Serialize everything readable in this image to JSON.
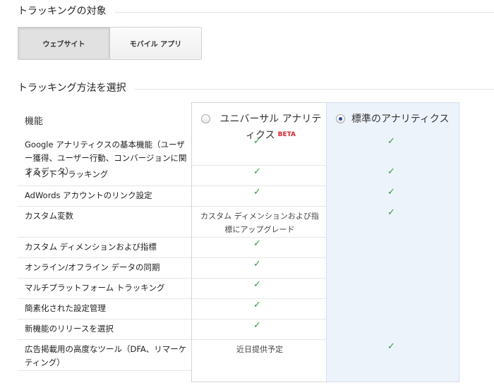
{
  "tracking_target": {
    "title": "トラッキングの対象",
    "tabs": [
      {
        "label": "ウェブサイト",
        "active": true
      },
      {
        "label": "モバイル アプリ",
        "active": false
      }
    ]
  },
  "tracking_method": {
    "title": "トラッキング方法を選択",
    "feature_header": "機能",
    "options": [
      {
        "label": "ユニバーサル アナリティクス",
        "badge": "BETA",
        "selected": false
      },
      {
        "label": "標準のアナリティクス",
        "selected": true
      }
    ],
    "rows": [
      {
        "feature": "Google アナリティクスの基本機能（ユーザー獲得、ユーザー行動、コンバージョンに関するデータ）",
        "universal": "check",
        "standard": "check"
      },
      {
        "feature": "イベント トラッキング",
        "universal": "check",
        "standard": "check"
      },
      {
        "feature": "AdWords アカウントのリンク設定",
        "universal": "check",
        "standard": "check"
      },
      {
        "feature": "カスタム変数",
        "universal": "カスタム ディメンションおよび指標にアップグレード",
        "standard": "check"
      },
      {
        "feature": "カスタム ディメンションおよび指標",
        "universal": "check",
        "standard": ""
      },
      {
        "feature": "オンライン/オフライン データの同期",
        "universal": "check",
        "standard": ""
      },
      {
        "feature": "マルチプラットフォーム トラッキング",
        "universal": "check",
        "standard": ""
      },
      {
        "feature": "簡素化された設定管理",
        "universal": "check",
        "standard": ""
      },
      {
        "feature": "新機能のリリースを選択",
        "universal": "check",
        "standard": ""
      },
      {
        "feature": "広告掲載用の高度なツール（DFA、リマーケティング）",
        "universal": "近日提供予定",
        "standard": "check"
      }
    ],
    "check_glyph": "✓"
  }
}
